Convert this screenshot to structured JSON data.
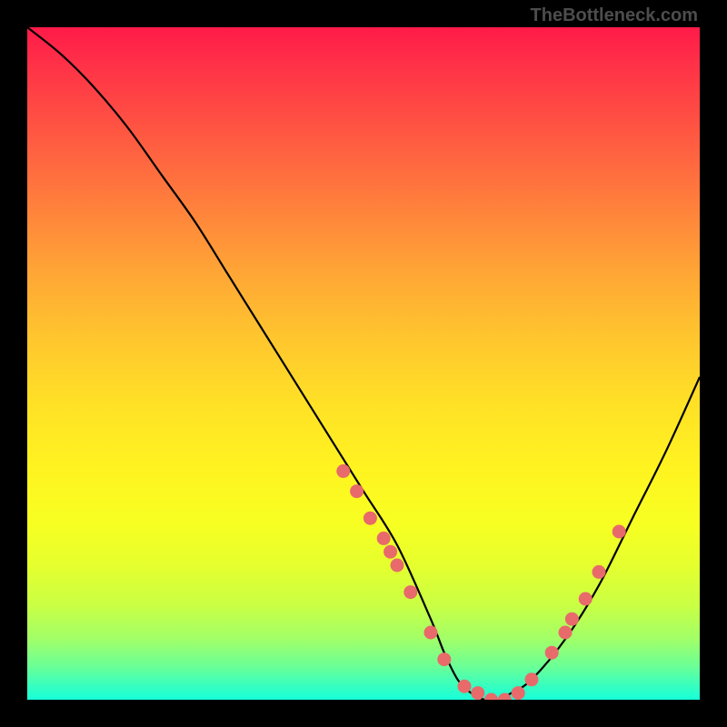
{
  "watermark": "TheBottleneck.com",
  "chart_data": {
    "type": "line",
    "title": "",
    "xlabel": "",
    "ylabel": "",
    "xlim": [
      0,
      100
    ],
    "ylim": [
      0,
      100
    ],
    "series": [
      {
        "name": "bottleneck-curve",
        "x": [
          0,
          5,
          10,
          15,
          20,
          25,
          30,
          35,
          40,
          45,
          50,
          55,
          60,
          62,
          64,
          66,
          68,
          70,
          72,
          75,
          80,
          85,
          90,
          95,
          100
        ],
        "y": [
          100,
          96,
          91,
          85,
          78,
          71,
          63,
          55,
          47,
          39,
          31,
          23,
          12,
          7,
          3,
          1,
          0,
          0,
          1,
          3,
          9,
          17,
          27,
          37,
          48
        ]
      }
    ],
    "markers": {
      "name": "highlighted-points",
      "color": "#e86a6a",
      "points": [
        {
          "x": 47,
          "y": 34
        },
        {
          "x": 49,
          "y": 31
        },
        {
          "x": 51,
          "y": 27
        },
        {
          "x": 53,
          "y": 24
        },
        {
          "x": 54,
          "y": 22
        },
        {
          "x": 55,
          "y": 20
        },
        {
          "x": 57,
          "y": 16
        },
        {
          "x": 60,
          "y": 10
        },
        {
          "x": 62,
          "y": 6
        },
        {
          "x": 65,
          "y": 2
        },
        {
          "x": 67,
          "y": 1
        },
        {
          "x": 69,
          "y": 0
        },
        {
          "x": 71,
          "y": 0
        },
        {
          "x": 73,
          "y": 1
        },
        {
          "x": 75,
          "y": 3
        },
        {
          "x": 78,
          "y": 7
        },
        {
          "x": 80,
          "y": 10
        },
        {
          "x": 81,
          "y": 12
        },
        {
          "x": 83,
          "y": 15
        },
        {
          "x": 85,
          "y": 19
        },
        {
          "x": 88,
          "y": 25
        }
      ]
    },
    "gradient_stops": [
      {
        "pct": 0,
        "color": "#ff1a49"
      },
      {
        "pct": 50,
        "color": "#ffd428"
      },
      {
        "pct": 80,
        "color": "#e5ff2e"
      },
      {
        "pct": 100,
        "color": "#17ffd8"
      }
    ]
  }
}
